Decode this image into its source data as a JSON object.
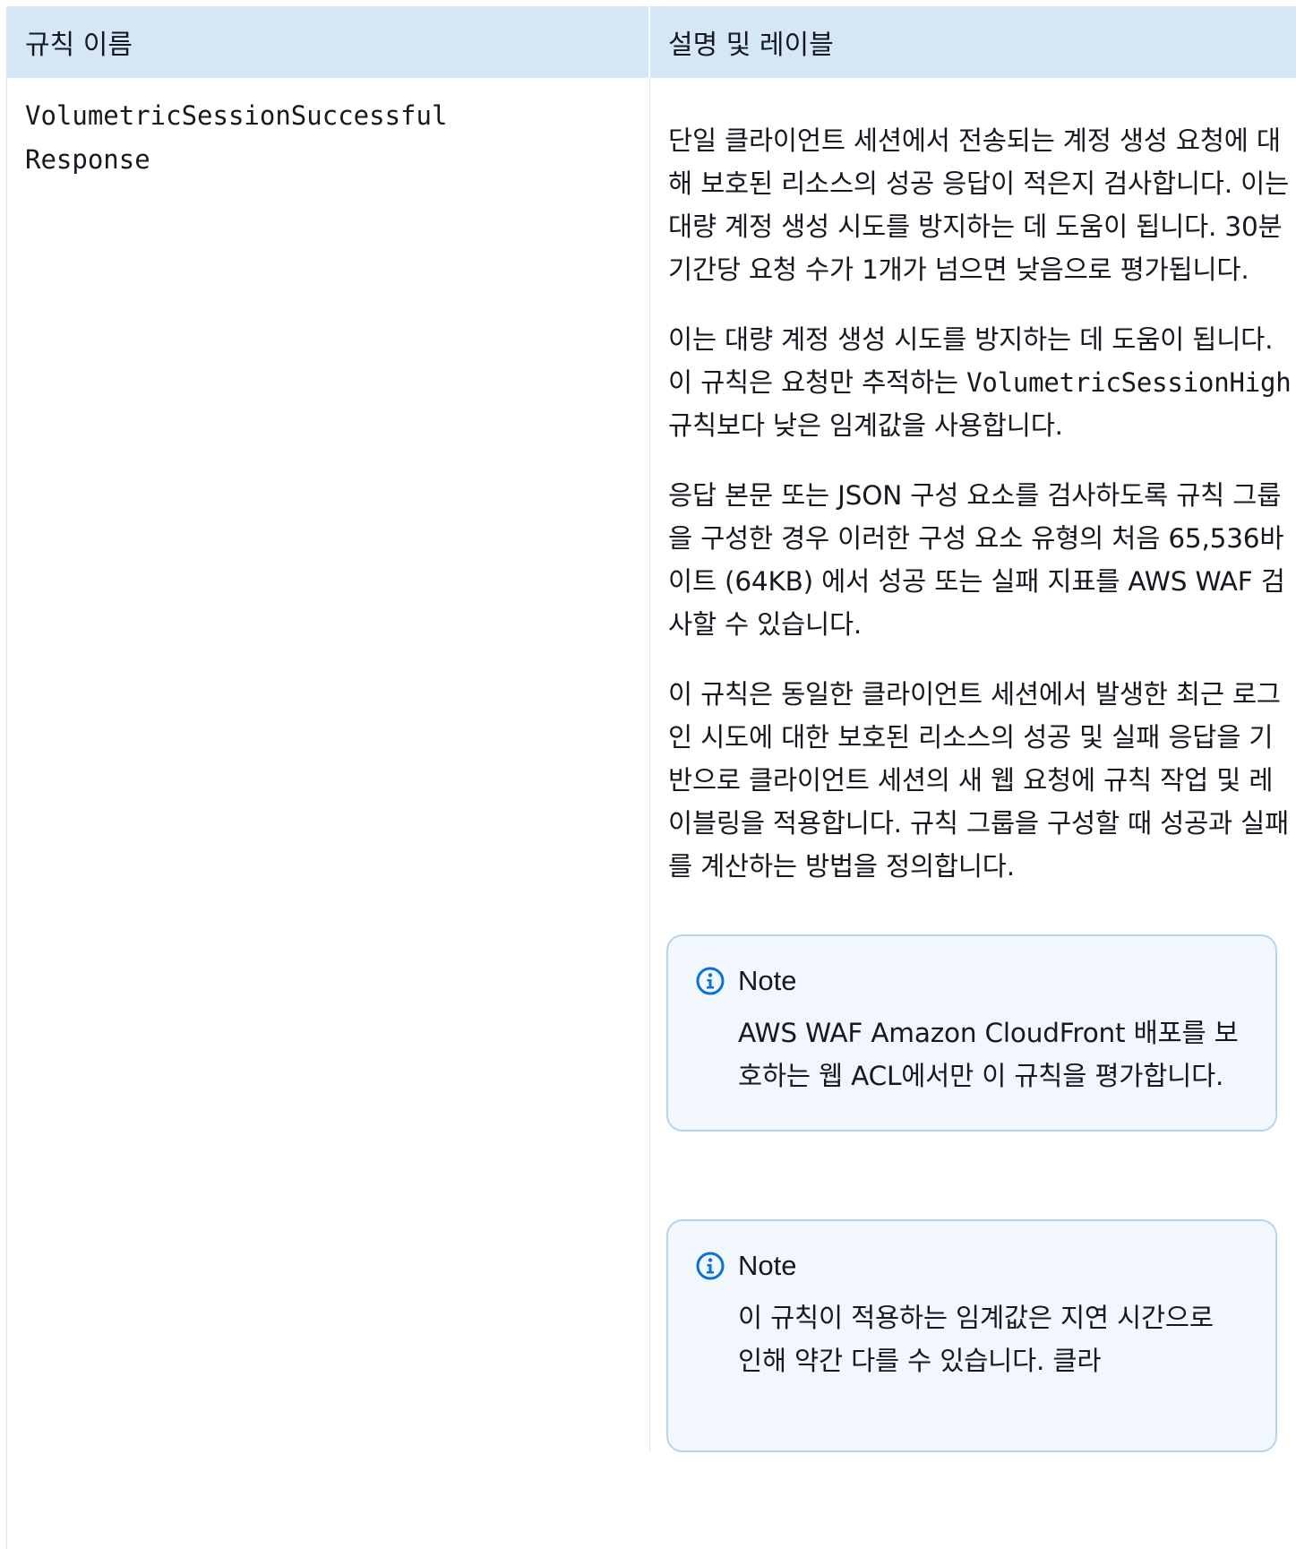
{
  "table": {
    "headers": {
      "rule_name": "규칙 이름",
      "description": "설명 및 레이블"
    },
    "row": {
      "rule_name": "VolumetricSessionSuccessful\nResponse",
      "paragraphs": {
        "p1": "단일 클라이언트 세션에서 전송되는 계정 생성 요청에 대해 보호된 리소스의 성공 응답이 적은지 검사합니다. 이는 대량 계정 생성 시도를 방지하는 데 도움이 됩니다. 30분 기간당 요청 수가 1개가 넘으면 낮음으로 평가됩니다.",
        "p2_before": "이는 대량 계정 생성 시도를 방지하는 데 도움이 됩니다. 이 규칙은 요청만 추적하는 ",
        "p2_code": "VolumetricSessionHigh",
        "p2_after": "    규칙보다 낮은 임계값을 사용합니다.",
        "p3": "응답 본문 또는 JSON 구성 요소를 검사하도록 규칙 그룹을 구성한 경우 이러한 구성 요소 유형의 처음 65,536바이트 (64KB) 에서 성공 또는 실패 지표를 AWS WAF 검사할 수 있습니다.",
        "p4": "이 규칙은 동일한 클라이언트 세션에서 발생한 최근 로그인 시도에 대한 보호된 리소스의 성공 및 실패 응답을 기반으로 클라이언트 세션의 새 웹 요청에 규칙 작업 및 레이블링을 적용합니다. 규칙 그룹을 구성할 때 성공과 실패를 계산하는 방법을 정의합니다."
      },
      "notes": [
        {
          "title": "Note",
          "body": "AWS WAF Amazon CloudFront 배포를 보호하는 웹 ACL에서만 이 규칙을 평가합니다."
        },
        {
          "title": "Note",
          "body": "이 규칙이 적용하는 임계값은 지연 시간으로 인해 약간 다를 수 있습니다. 클라"
        }
      ]
    }
  },
  "icons": {
    "note_icon": "info-circle-icon",
    "note_icon_color": "#0972d3"
  }
}
